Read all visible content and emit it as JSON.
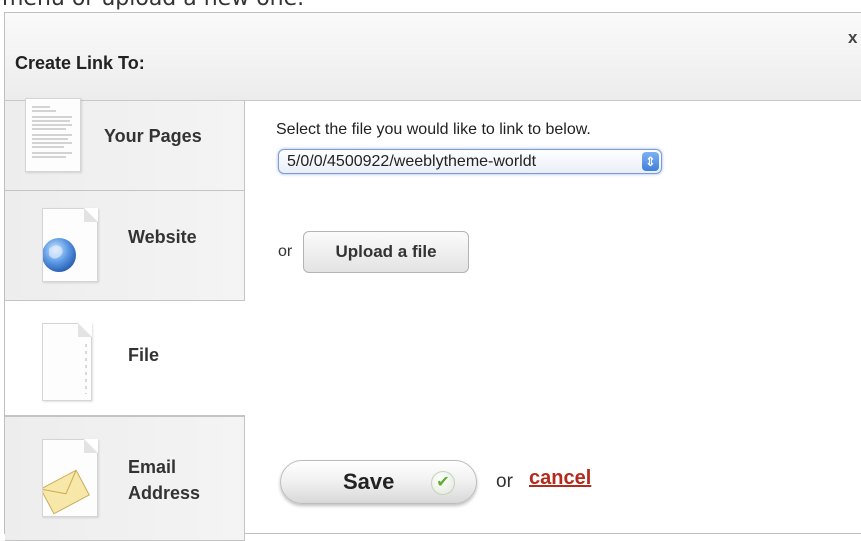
{
  "background_text": "menu or upload a new one.",
  "dialog": {
    "title": "Create Link To:",
    "close_glyph": "x"
  },
  "sidebar": {
    "items": [
      {
        "label": "Your Pages",
        "icon": "document-page-icon"
      },
      {
        "label": "Website",
        "icon": "globe-icon"
      },
      {
        "label": "File",
        "icon": "file-icon"
      },
      {
        "label_line1": "Email",
        "label_line2": "Address",
        "icon": "envelope-icon"
      }
    ],
    "active_index": 2
  },
  "main": {
    "select_prompt": "Select the file you would like to link to below.",
    "file_select_value": "5/0/0/4500922/weeblytheme-worldt",
    "select_arrows_glyph": "⇕",
    "or_text": "or",
    "upload_button_label": "Upload a file",
    "save_button_label": "Save",
    "save_check_glyph": "✔",
    "or_cancel_text": "or",
    "cancel_link_label": "cancel"
  },
  "colors": {
    "cancel_link": "#b32b1c",
    "select_focus": "#7d9bd4",
    "check_green": "#5fae2f"
  }
}
